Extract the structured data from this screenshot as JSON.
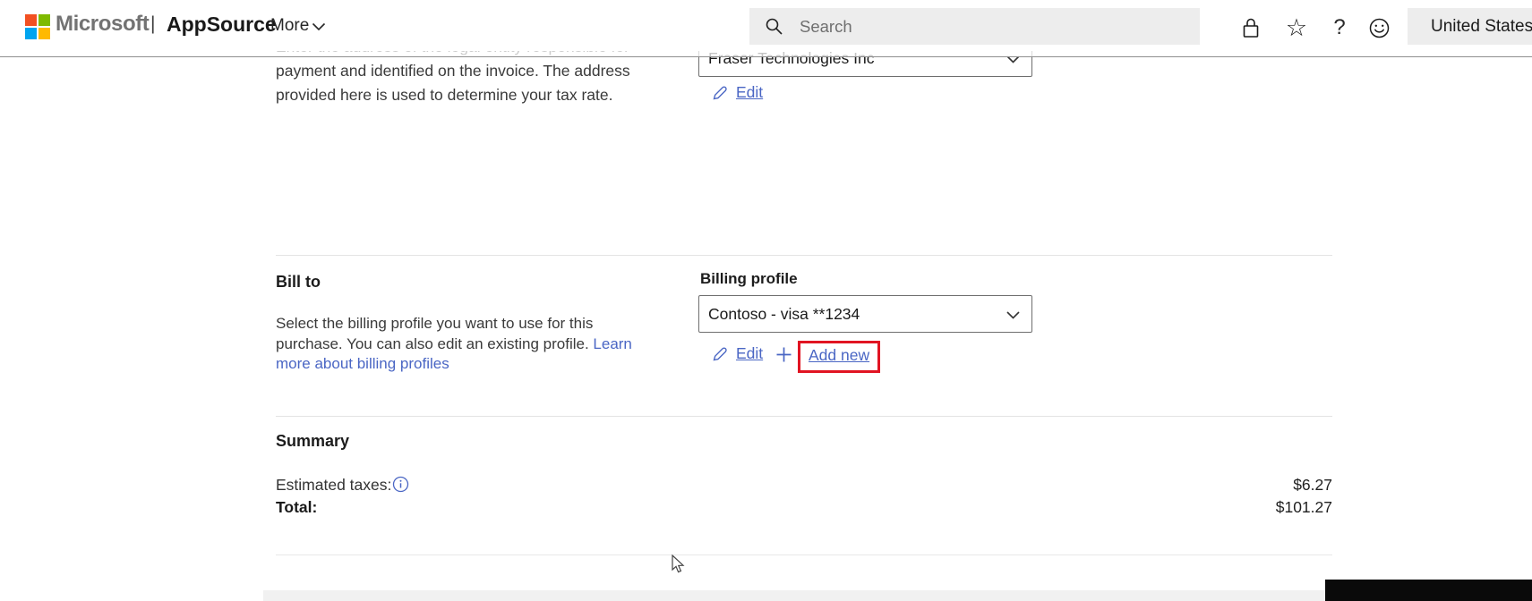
{
  "header": {
    "brand": {
      "microsoft": "Microsoft",
      "separator": "|",
      "product": "AppSource"
    },
    "nav": {
      "more": "More"
    },
    "search": {
      "placeholder": "Search"
    },
    "region": {
      "label": "United States"
    },
    "icons": [
      "search-icon",
      "lock-icon",
      "star-icon",
      "help-icon",
      "feedback-smiley-icon",
      "globe-icon"
    ]
  },
  "sold_to": {
    "description": {
      "line1": "Enter the address of the legal entity responsible for",
      "line2": "payment and identified on the invoice. The address",
      "line3": "provided here is used to determine your tax rate."
    },
    "dropdown_value": "Fraser Technologies Inc",
    "edit": "Edit"
  },
  "bill_to": {
    "title": "Bill to",
    "description": {
      "line1": "Select the billing profile you want to use for this",
      "line2_plain": "purchase. You can also edit an existing profile. ",
      "line2_link": "Learn",
      "line3_link": "more about billing profiles"
    },
    "field_label": "Billing profile",
    "dropdown_value": "Contoso - visa **1234",
    "edit": "Edit",
    "add_new": "Add new"
  },
  "summary": {
    "title": "Summary",
    "estimated_taxes_label": "Estimated taxes:",
    "estimated_taxes_value": "$6.27",
    "total_label": "Total:",
    "total_value": "$101.27"
  },
  "colors": {
    "link": "#4a66c4",
    "annotation_red": "#e11422",
    "control_bg": "#ededed",
    "logo_red": "#f25022",
    "logo_green": "#7fba00",
    "logo_blue": "#00a4ef",
    "logo_yellow": "#ffb900"
  }
}
